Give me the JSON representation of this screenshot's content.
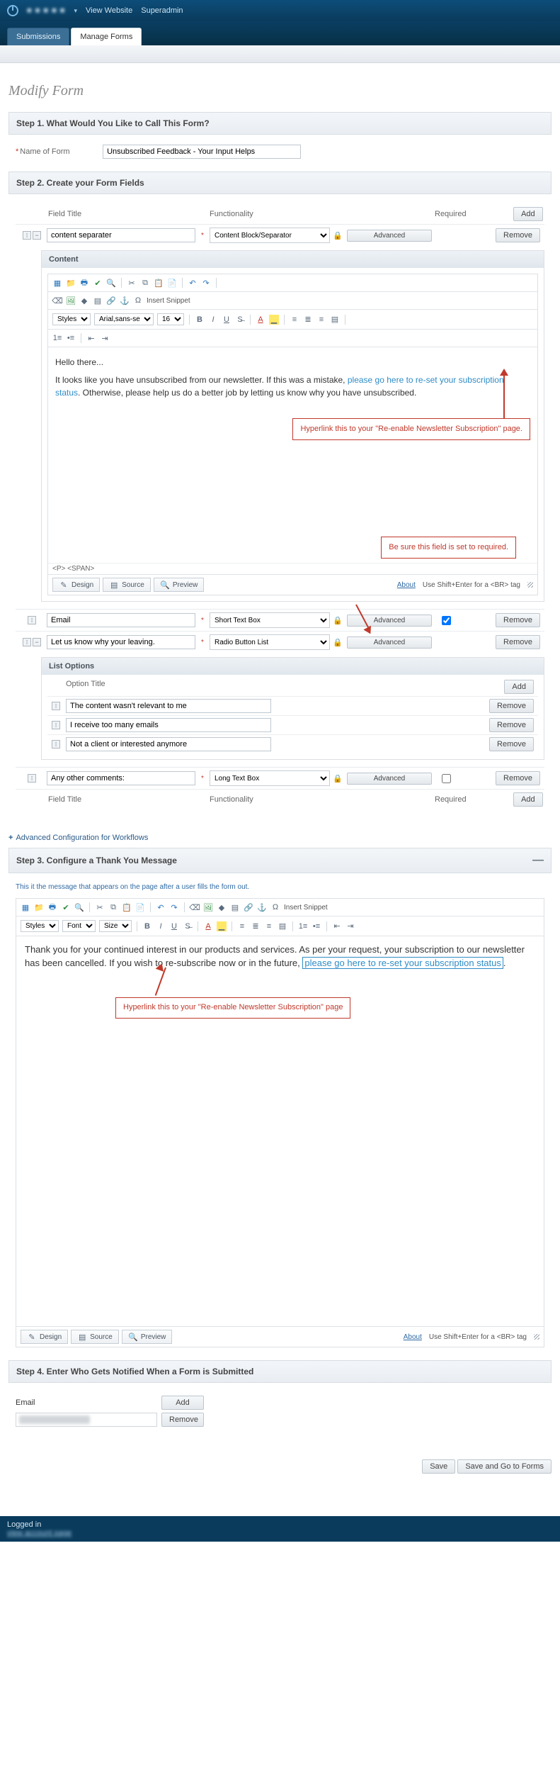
{
  "top": {
    "view_website": "View Website",
    "superadmin": "Superadmin",
    "brand": "■ ■ ■ ■ ■"
  },
  "tabs": {
    "submissions": "Submissions",
    "manage": "Manage Forms"
  },
  "page_title": "Modify Form",
  "step1": {
    "heading": "Step 1. What Would You Like to Call This Form?",
    "label": "Name of Form",
    "value": "Unsubscribed Feedback - Your Input Helps"
  },
  "step2": {
    "heading": "Step 2. Create your Form Fields",
    "col_title": "Field Title",
    "col_func": "Functionality",
    "col_req": "Required",
    "add": "Add",
    "remove": "Remove",
    "advanced": "Advanced",
    "row1_title": "content separater",
    "row1_func": "Content Block/Separator",
    "content_hd": "Content",
    "styles": "Styles",
    "font": "Arial,sans-se",
    "size": "16",
    "snippet": "Insert Snippet",
    "greet": "Hello there...",
    "body_p1": "It looks like you have unsubscribed from our newsletter. If this was a mistake, ",
    "body_link": "please go here to re-set your subscription status",
    "body_p2": ". Otherwise, please help us do a better job by letting us know why you have unsubscribed.",
    "callout1": "Hyperlink this to your \"Re-enable Newsletter Subscription\" page.",
    "callout2": "Be sure this field is set to required.",
    "path": "<P>  <SPAN>",
    "design": "Design",
    "source": "Source",
    "preview": "Preview",
    "about": "About",
    "shift_hint": "Use Shift+Enter for a <BR> tag",
    "row2_title": "Email",
    "row2_func": "Short Text Box",
    "row3_title": "Let us know why your leaving.",
    "row3_func": "Radio Button List",
    "listopts_hd": "List Options",
    "opt_col": "Option Title",
    "opt1": "The content wasn't relevant to me",
    "opt2": "I receive too many emails",
    "opt3": "Not a client or interested anymore",
    "row4_title": "Any other comments:",
    "row4_func": "Long Text Box"
  },
  "adv": "Advanced Configuration for Workflows",
  "step3": {
    "heading": "Step 3. Configure a Thank You Message",
    "hint": "This it the message that appears on the page after a user fills the form out.",
    "styles": "Styles",
    "font": "Font",
    "size": "Size",
    "snippet": "Insert Snippet",
    "p1": "Thank you for your continued interest in our products and services. As per your request, your subscription to our newsletter has been cancelled. If you wish to re-subscribe now or in the future, ",
    "link": "please go here to re-set your subscription status",
    "period": ".",
    "callout": "Hyperlink this to your \"Re-enable Newsletter Subscription\" page"
  },
  "step4": {
    "heading": "Step 4. Enter Who Gets Notified When a Form is Submitted",
    "email_label": "Email",
    "add": "Add",
    "remove": "Remove"
  },
  "buttons": {
    "save": "Save",
    "save_go": "Save and Go to Forms"
  },
  "footer": {
    "logged": "Logged in",
    "link": "view account page"
  }
}
